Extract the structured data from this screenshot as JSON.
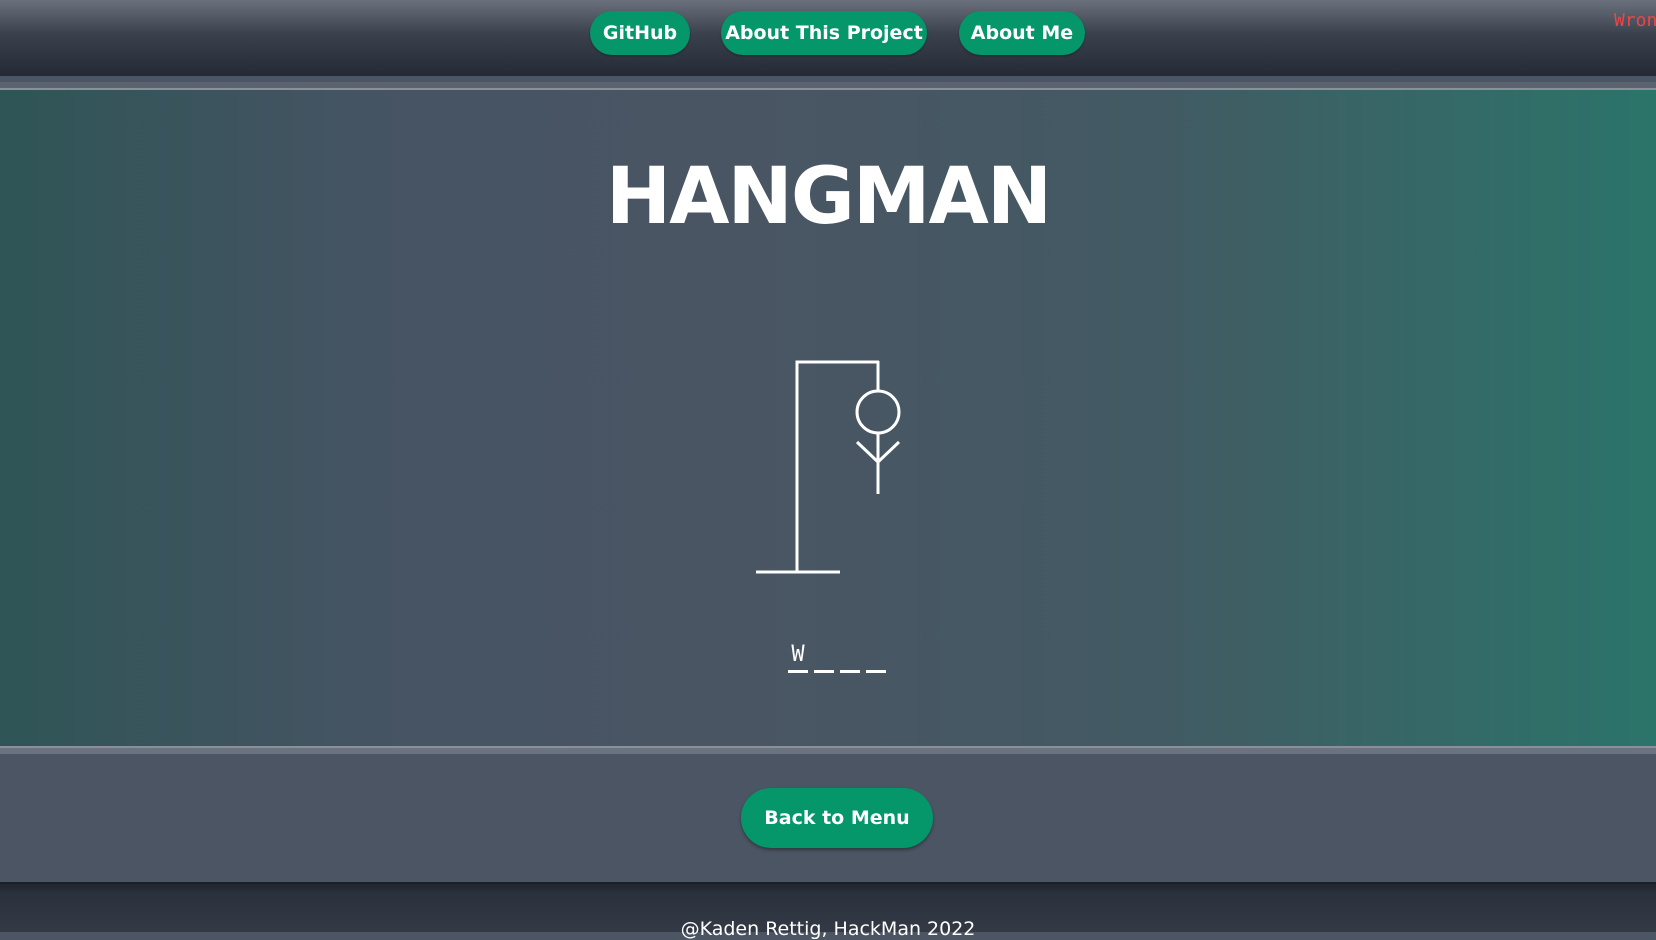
{
  "nav": {
    "items": [
      {
        "label": "GitHub"
      },
      {
        "label": "About This Project"
      },
      {
        "label": "About Me"
      }
    ]
  },
  "status": {
    "wrong_label": "Wrong"
  },
  "game": {
    "title": "HANGMAN",
    "word_slots": [
      "W",
      "",
      "",
      ""
    ],
    "hangman_parts_shown": [
      "head",
      "body",
      "left-arm",
      "right-arm"
    ]
  },
  "actions": {
    "back_label": "Back to Menu"
  },
  "footer": {
    "text": "@Kaden Rettig, HackMan 2022"
  },
  "colors": {
    "accent": "#059669",
    "wrong_text": "#ef4444",
    "text": "#ffffff"
  }
}
